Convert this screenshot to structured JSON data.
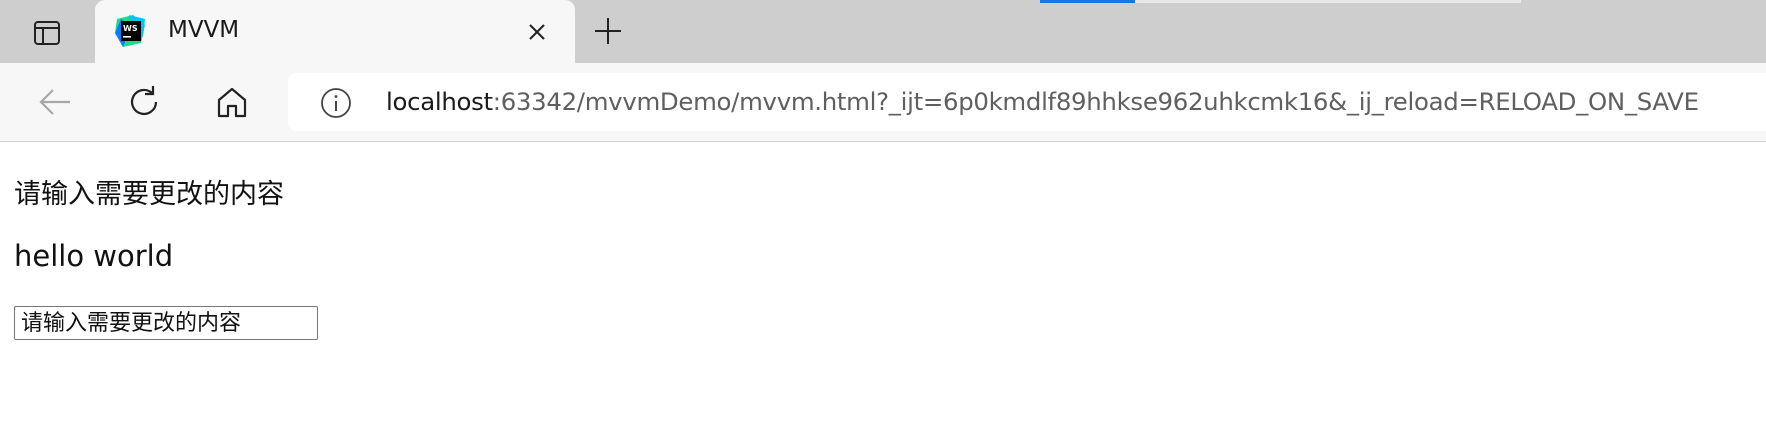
{
  "tab": {
    "title": "MVVM",
    "favicon_icon": "webstorm-logo-icon",
    "favicon_text": "WS"
  },
  "toolbar": {
    "back_icon": "back-arrow-icon",
    "reload_icon": "reload-icon",
    "home_icon": "home-icon"
  },
  "addressbar": {
    "info_icon": "info-icon",
    "url_host": "localhost",
    "url_rest": ":63342/mvvmDemo/mvvm.html?_ijt=6p0kmdlf89hhkse962uhkcmk16&_ij_reload=RELOAD_ON_SAVE"
  },
  "page": {
    "prompt": "请输入需要更改的内容",
    "message": "hello world",
    "input_placeholder": "请输入需要更改的内容"
  },
  "colors": {
    "tabstrip_bg": "#cecece",
    "toolbar_bg": "#f7f7f7",
    "load_indicator": "#1a73e8"
  }
}
